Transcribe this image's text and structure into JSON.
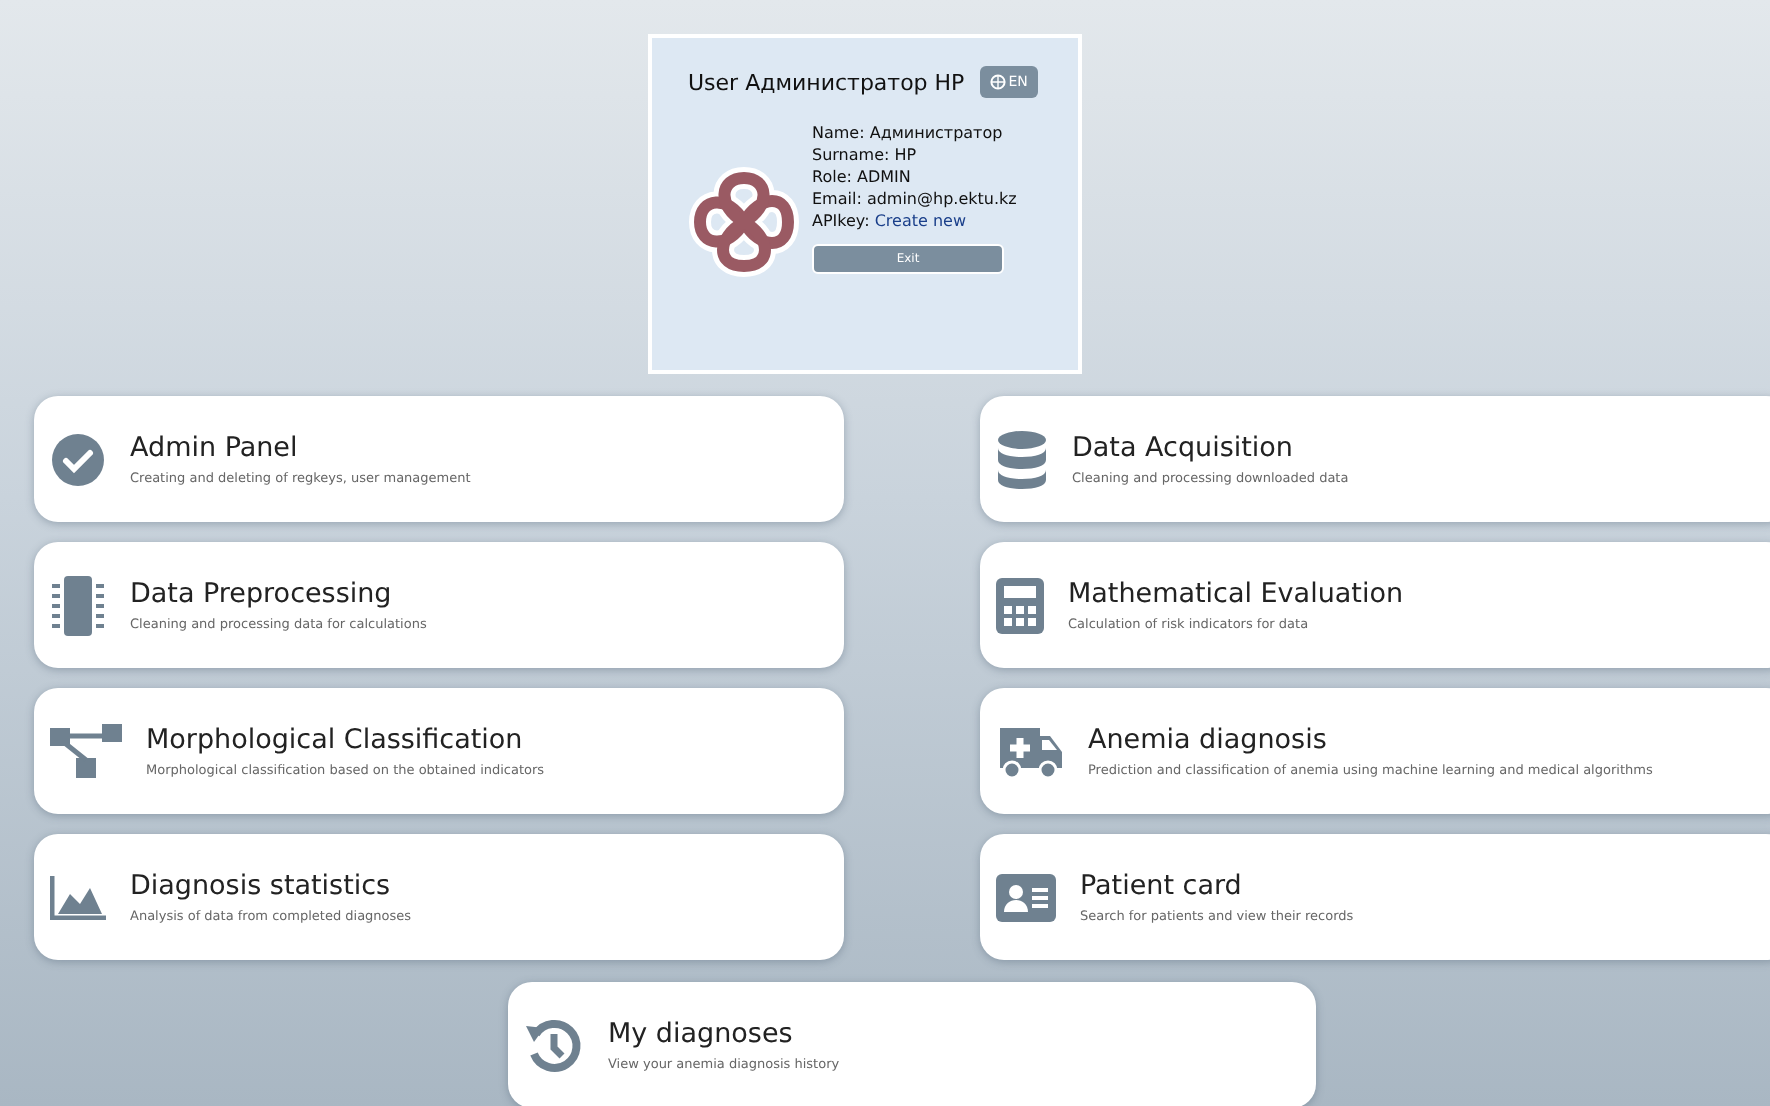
{
  "user_card": {
    "title": "User Администратор HP",
    "language_button": "EN",
    "fields": [
      {
        "label": "Name:",
        "value": "Администратор"
      },
      {
        "label": "Surname:",
        "value": "HP"
      },
      {
        "label": "Role:",
        "value": "ADMIN"
      },
      {
        "label": "Email:",
        "value": "admin@hp.ektu.kz"
      },
      {
        "label": "APIkey:",
        "link": "Create new"
      }
    ],
    "exit_button": "Exit"
  },
  "modules": [
    {
      "title": "Admin Panel",
      "description": "Creating and deleting of regkeys, user management"
    },
    {
      "title": "Data Acquisition",
      "description": "Cleaning and processing downloaded data"
    },
    {
      "title": "Data Preprocessing",
      "description": "Cleaning and processing data for calculations"
    },
    {
      "title": "Mathematical Evaluation",
      "description": "Calculation of risk indicators for data"
    },
    {
      "title": "Morphological Classification",
      "description": "Morphological classification based on the obtained indicators"
    },
    {
      "title": "Anemia diagnosis",
      "description": "Prediction and classification of anemia using machine learning and medical algorithms"
    },
    {
      "title": "Diagnosis statistics",
      "description": "Analysis of data from completed diagnoses"
    },
    {
      "title": "Patient card",
      "description": "Search for patients and view their records"
    },
    {
      "title": "My diagnoses",
      "description": "View your anemia diagnosis history"
    }
  ]
}
